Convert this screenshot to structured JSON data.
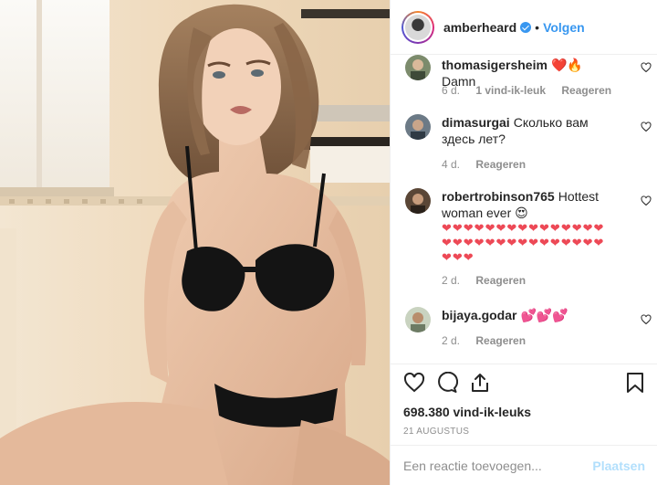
{
  "header": {
    "username": "amberheard",
    "separator": "•",
    "follow_label": "Volgen"
  },
  "comments": [
    {
      "user": "thomasigersheim",
      "text": "❤️🔥 Damn",
      "time": "6 d.",
      "likes": "1 vind-ik-leuk",
      "reply": "Reageren"
    },
    {
      "user": "dimasurgai",
      "text": "Сколько вам здесь лет?",
      "time": "4 d.",
      "likes": "",
      "reply": "Reageren"
    },
    {
      "user": "robertrobinson765",
      "text": "Hottest woman ever 😍",
      "hearts": "❤❤❤❤❤❤❤❤❤❤❤❤❤❤❤❤❤❤❤❤❤❤❤❤❤❤❤❤❤❤❤❤❤",
      "time": "2 d.",
      "likes": "",
      "reply": "Reageren"
    },
    {
      "user": "bijaya.godar",
      "text": "💕💕💕",
      "time": "2 d.",
      "likes": "",
      "reply": "Reageren"
    }
  ],
  "actions": {
    "like_count": "698.380 vind-ik-leuks",
    "date": "21 AUGUSTUS"
  },
  "add_comment": {
    "placeholder": "Een reactie toevoegen...",
    "post_label": "Plaatsen"
  },
  "colors": {
    "link": "#3897f0",
    "heart": "#ed4956",
    "muted": "#8e8e8e",
    "post_disabled": "#b2dffc"
  }
}
